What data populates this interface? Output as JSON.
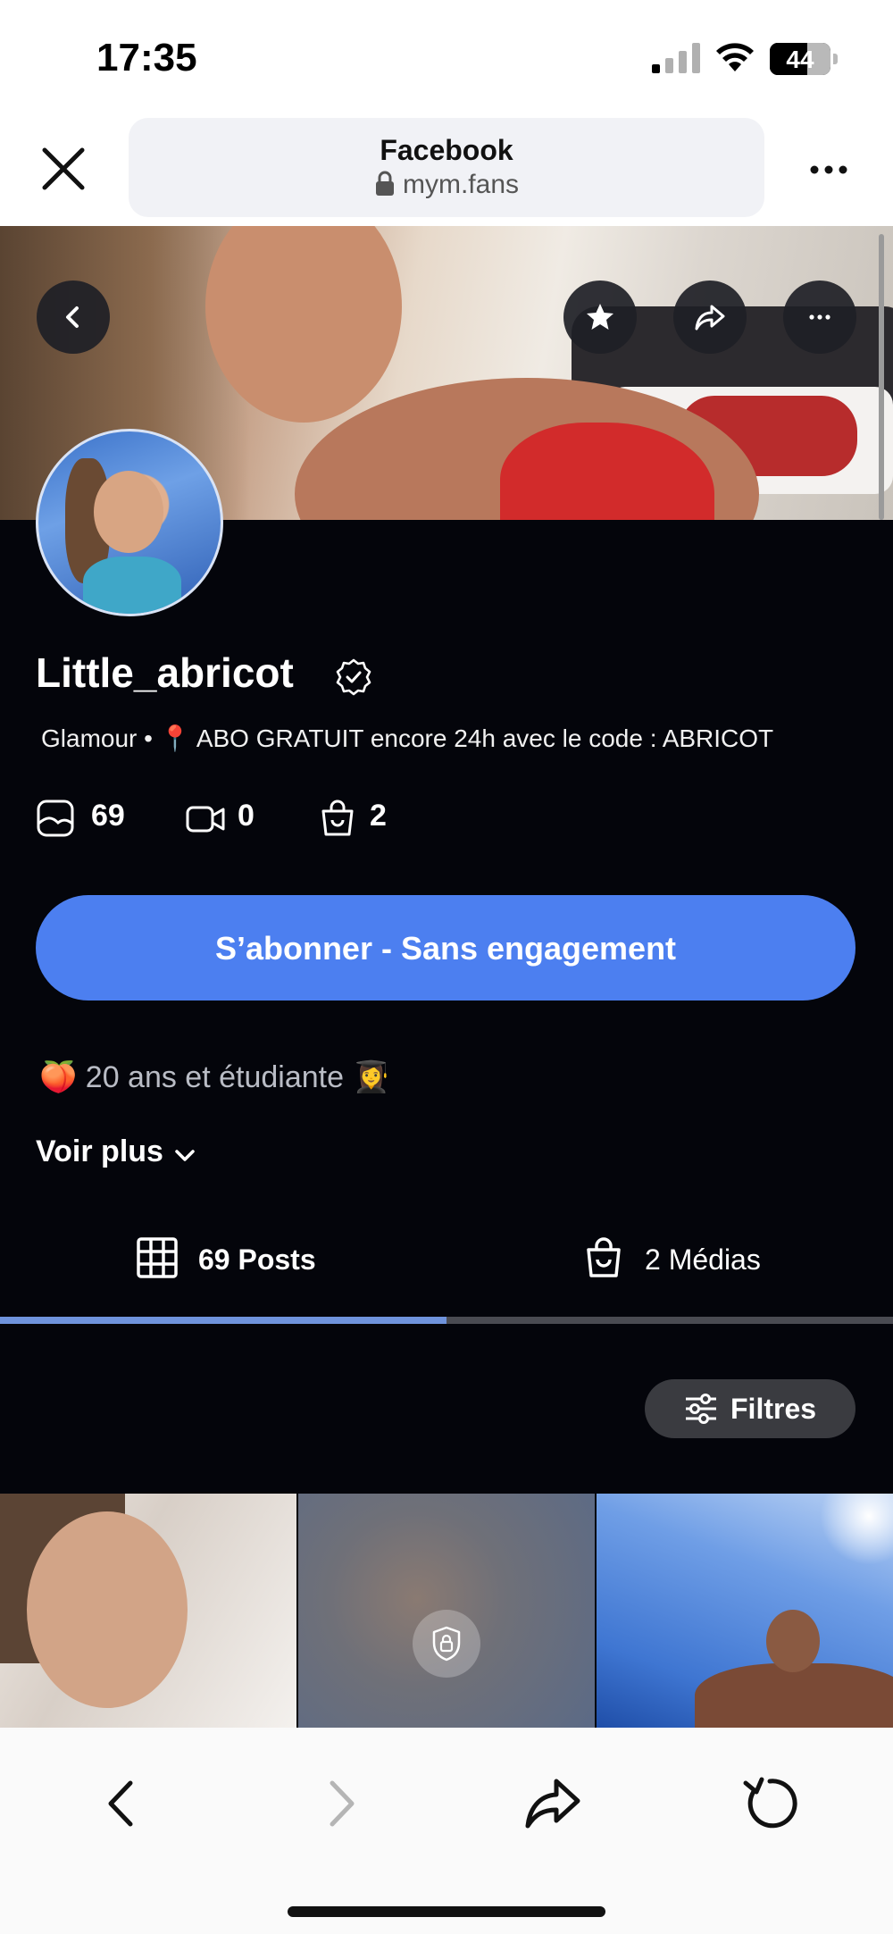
{
  "status_bar": {
    "time": "17:35",
    "battery": "44"
  },
  "browser": {
    "title": "Facebook",
    "url": "mym.fans"
  },
  "profile": {
    "name": "Little_abricot",
    "bio": "Glamour • 📍 ABO GRATUIT encore 24h avec le code : ABRICOT",
    "stats": {
      "photos": "69",
      "videos": "0",
      "medias": "2"
    },
    "subscribe_label": "S’abonner - Sans engagement",
    "tagline": "🍑 20 ans et étudiante 👩‍🎓",
    "see_more_label": "Voir plus"
  },
  "tabs": [
    {
      "label": "69 Posts",
      "active": true,
      "icon": "grid-icon"
    },
    {
      "label": "2 Médias",
      "active": false,
      "icon": "shopping-bag-icon"
    }
  ],
  "filters_label": "Filtres",
  "colors": {
    "accent": "#4c7ff0",
    "background": "#04050b",
    "tab_active": "#6f93dc"
  }
}
